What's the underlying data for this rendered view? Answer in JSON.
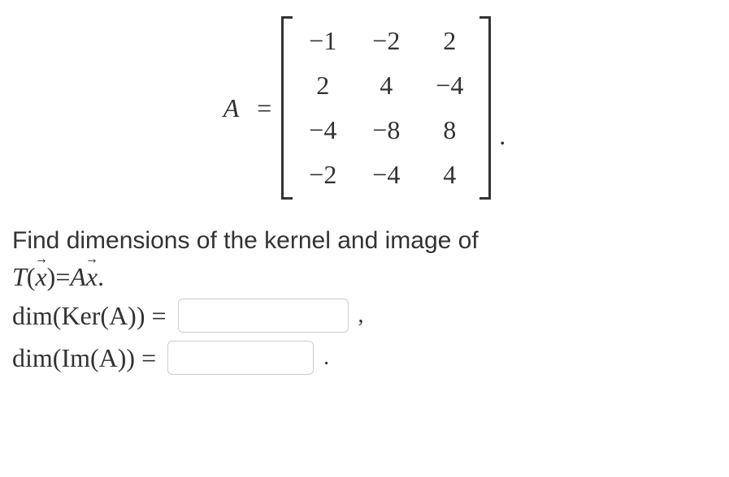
{
  "equation": {
    "lhs": "A",
    "eq": "=",
    "matrix": {
      "rows": [
        [
          "−1",
          "−2",
          "2"
        ],
        [
          "2",
          "4",
          "−4"
        ],
        [
          "−4",
          "−8",
          "8"
        ],
        [
          "−2",
          "−4",
          "4"
        ]
      ]
    },
    "trailing_period": "."
  },
  "question": {
    "text": "Find dimensions of the kernel and image of",
    "transform_lhs_T": "T",
    "transform_paren_open": "(",
    "transform_x": "x",
    "transform_paren_close": ")",
    "transform_eq": " = ",
    "transform_A": "A",
    "transform_x2": "x",
    "transform_period": "."
  },
  "answers": {
    "ker": {
      "label_dim": "dim",
      "label_open": "(",
      "label_ker": "Ker",
      "label_openA": "(",
      "label_A": "A",
      "label_closeA": "))",
      "eq": " = ",
      "value": "",
      "trailing": ","
    },
    "im": {
      "label_dim": "dim",
      "label_open": "(",
      "label_im": "Im",
      "label_openA": "(",
      "label_A": "A",
      "label_closeA": "))",
      "eq": " = ",
      "value": "",
      "trailing": "."
    }
  }
}
